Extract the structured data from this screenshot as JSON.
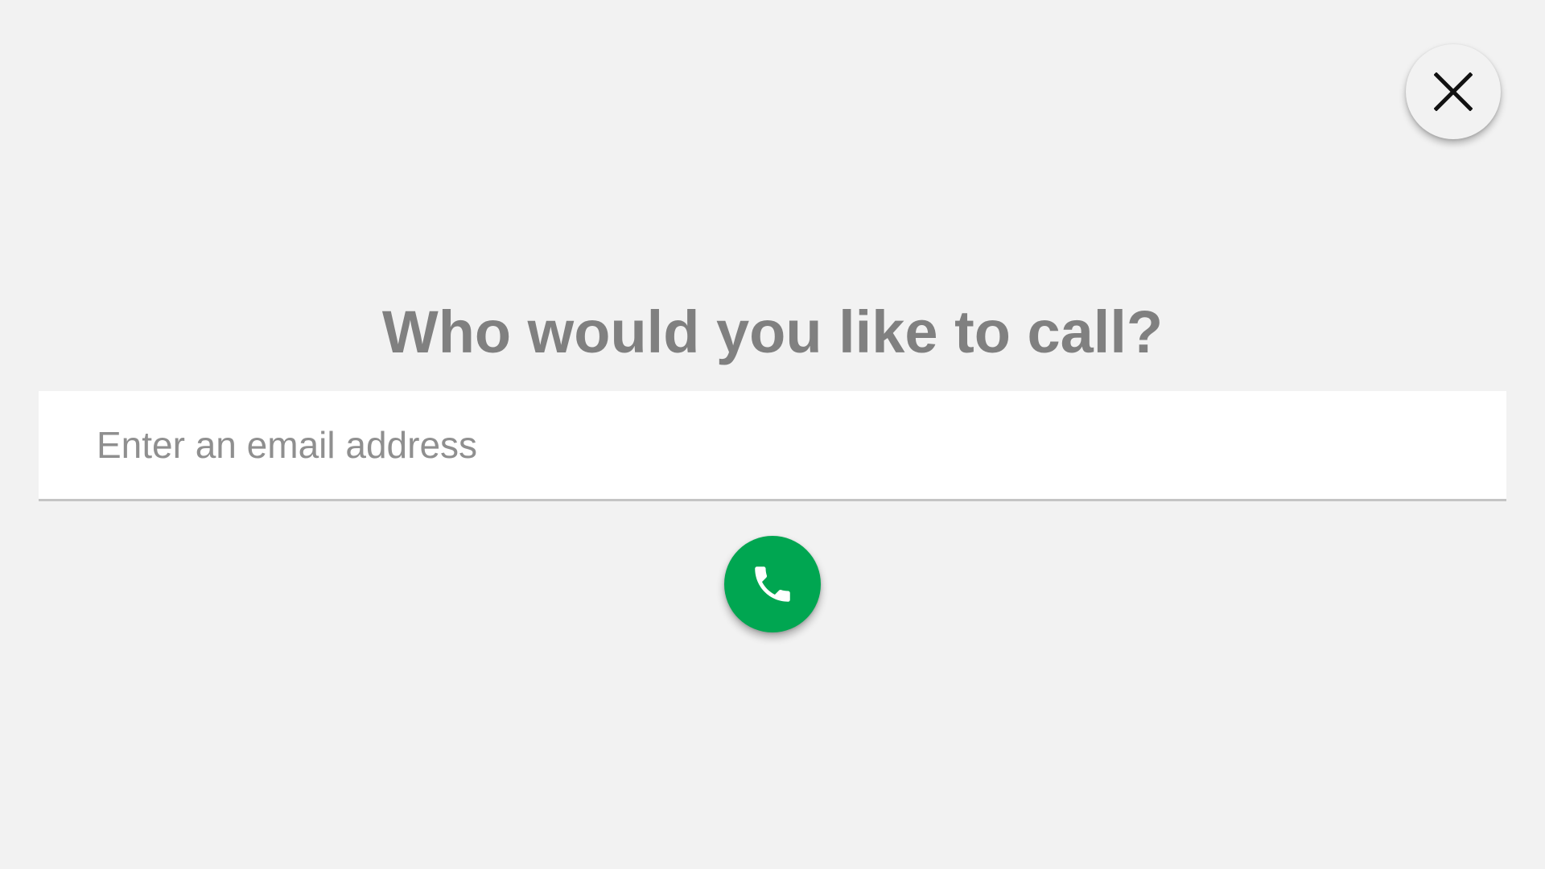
{
  "dialog": {
    "title": "Who would you like to call?",
    "email_input": {
      "placeholder": "Enter an email address",
      "value": ""
    },
    "close_button": {
      "icon": "close-icon"
    },
    "call_button": {
      "icon": "phone-icon"
    }
  },
  "colors": {
    "background": "#f2f2f2",
    "title_text": "#808080",
    "placeholder_text": "#8f8f8f",
    "call_button": "#00a651",
    "close_icon": "#111111"
  }
}
